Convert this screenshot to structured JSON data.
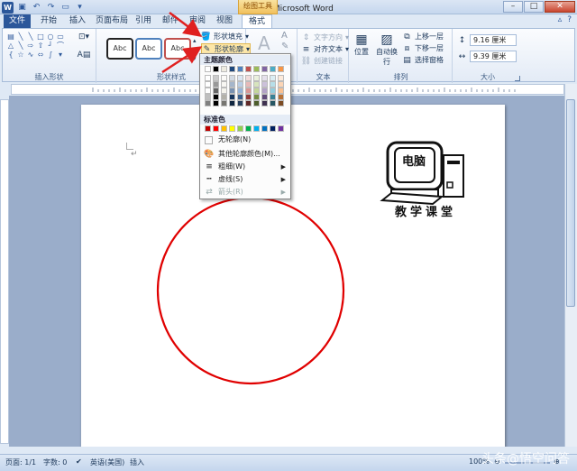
{
  "title_bar": {
    "doc_title": "文档1 - Microsoft Word",
    "context_tool": "绘图工具",
    "word_icon": "W"
  },
  "tabs": [
    {
      "label": "文件",
      "active": false
    },
    {
      "label": "开始"
    },
    {
      "label": "插入"
    },
    {
      "label": "页面布局"
    },
    {
      "label": "引用"
    },
    {
      "label": "邮件"
    },
    {
      "label": "审阅"
    },
    {
      "label": "视图"
    },
    {
      "label": "格式",
      "active": true
    }
  ],
  "ribbon": {
    "groups": {
      "insert_shapes": "插入形状",
      "shape_styles": "形状样式",
      "text": "文本",
      "arrange": "排列",
      "size": "大小"
    },
    "style_samples": [
      "Abc",
      "Abc",
      "Abc"
    ],
    "shape_fill": "形状填充",
    "shape_outline": "形状轮廓",
    "text_direction": "文字方向",
    "align_text": "对齐文本",
    "create_link": "创建链接",
    "position": "位置",
    "wrap_text": "自动换行",
    "bring_forward": "上移一层",
    "send_backward": "下移一层",
    "selection_pane": "选择窗格",
    "height": "9.16 厘米",
    "width": "9.39 厘米"
  },
  "menu": {
    "theme_colors": "主题颜色",
    "standard_colors": "标准色",
    "no_outline": "无轮廓(N)",
    "more_colors": "其他轮廓颜色(M)...",
    "weight": "粗细(W)",
    "dashes": "虚线(S)",
    "arrows": "箭头(R)",
    "theme_top": [
      "#ffffff",
      "#000000",
      "#eeece1",
      "#1f497d",
      "#4f81bd",
      "#c0504d",
      "#9bbb59",
      "#8064a2",
      "#4bacc6",
      "#f79646"
    ],
    "standard": [
      "#c00000",
      "#ff0000",
      "#ffc000",
      "#ffff00",
      "#92d050",
      "#00b050",
      "#00b0f0",
      "#0070c0",
      "#002060",
      "#7030a0"
    ]
  },
  "document": {
    "logo_title": "电脑",
    "logo_subtitle": "教学课堂",
    "circle_color": "#e00000"
  },
  "status_bar": {
    "page": "页面: 1/1",
    "words": "字数: 0",
    "language": "英语(美国)",
    "mode": "插入",
    "zoom": "100%"
  },
  "watermark": "头条@悟空问答"
}
